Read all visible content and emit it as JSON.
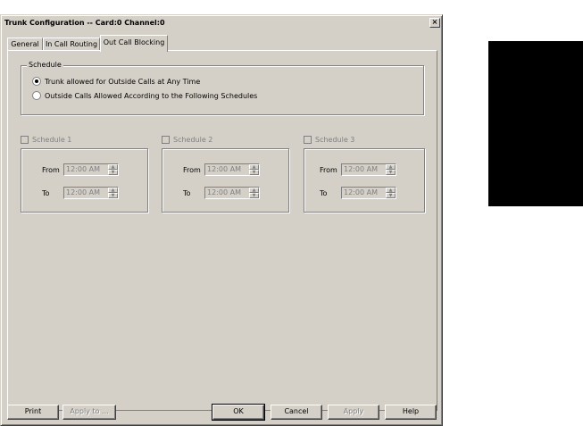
{
  "window": {
    "title": "Trunk Configuration -- Card:0 Channel:0",
    "close_glyph": "×"
  },
  "tabs": [
    {
      "label": "General",
      "active": false
    },
    {
      "label": "In Call Routing",
      "active": false
    },
    {
      "label": "Out Call Blocking",
      "active": true
    }
  ],
  "schedule_group": {
    "label": "Schedule",
    "options": [
      {
        "label": "Trunk allowed for Outside Calls at Any Time",
        "checked": true
      },
      {
        "label": "Outside Calls Allowed According to the Following Schedules",
        "checked": false
      }
    ]
  },
  "schedules": [
    {
      "label": "Schedule 1",
      "checked": false,
      "from_label": "From",
      "from_value": "12:00 AM",
      "to_label": "To",
      "to_value": "12:00 AM"
    },
    {
      "label": "Schedule 2",
      "checked": false,
      "from_label": "From",
      "from_value": "12:00 AM",
      "to_label": "To",
      "to_value": "12:00 AM"
    },
    {
      "label": "Schedule 3",
      "checked": false,
      "from_label": "From",
      "from_value": "12:00 AM",
      "to_label": "To",
      "to_value": "12:00 AM"
    }
  ],
  "buttons": {
    "print": "Print",
    "apply_to": "Apply to ...",
    "ok": "OK",
    "cancel": "Cancel",
    "apply": "Apply",
    "help": "Help"
  },
  "colors": {
    "face": "#d4d0c8",
    "shadow": "#808080",
    "highlight": "#ffffff",
    "disabled_text": "#808080"
  }
}
